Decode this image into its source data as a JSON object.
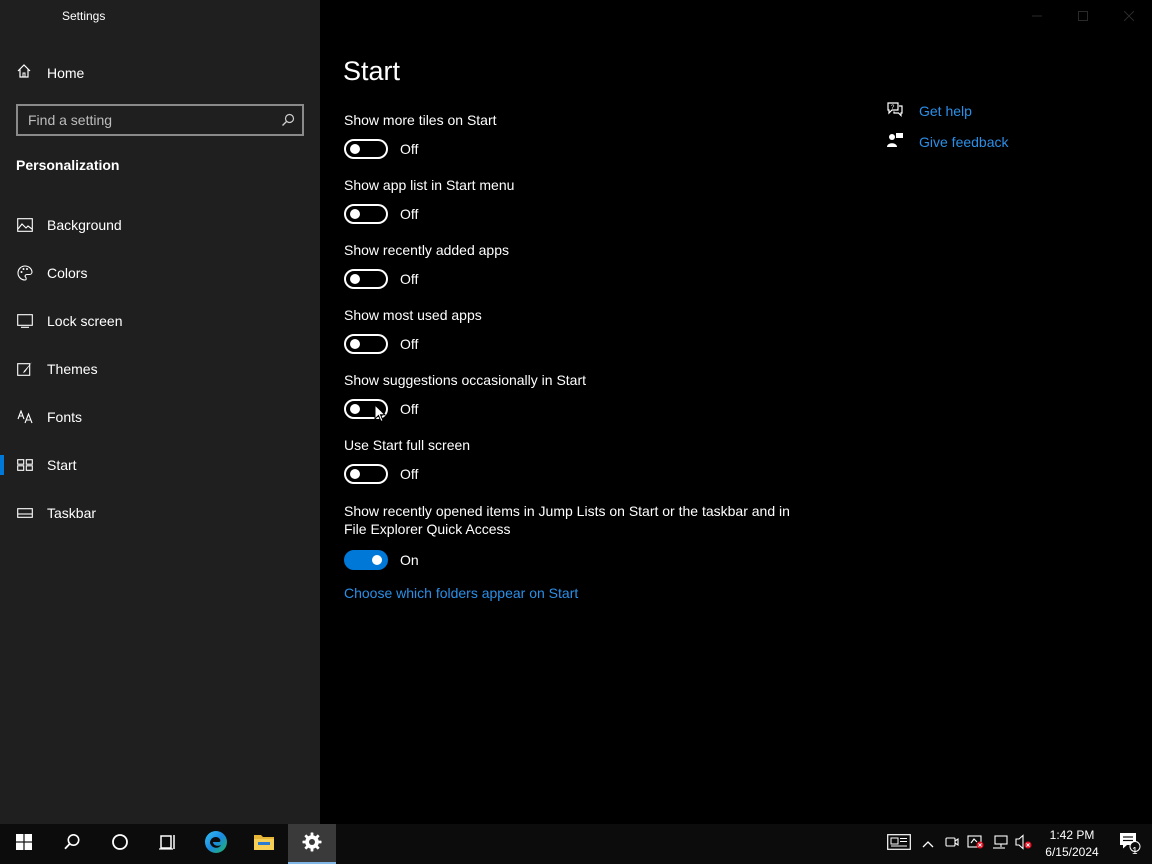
{
  "window": {
    "title": "Settings"
  },
  "sidebar": {
    "home_label": "Home",
    "search_placeholder": "Find a setting",
    "section_title": "Personalization",
    "items": [
      {
        "label": "Background",
        "icon": "picture-icon"
      },
      {
        "label": "Colors",
        "icon": "palette-icon"
      },
      {
        "label": "Lock screen",
        "icon": "lock-screen-icon"
      },
      {
        "label": "Themes",
        "icon": "brush-icon"
      },
      {
        "label": "Fonts",
        "icon": "font-icon"
      },
      {
        "label": "Start",
        "icon": "start-layout-icon",
        "active": true
      },
      {
        "label": "Taskbar",
        "icon": "taskbar-icon"
      }
    ]
  },
  "main": {
    "title": "Start",
    "settings": [
      {
        "label": "Show more tiles on Start",
        "state": "Off"
      },
      {
        "label": "Show app list in Start menu",
        "state": "Off"
      },
      {
        "label": "Show recently added apps",
        "state": "Off"
      },
      {
        "label": "Show most used apps",
        "state": "Off"
      },
      {
        "label": "Show suggestions occasionally in Start",
        "state": "Off"
      },
      {
        "label": "Use Start full screen",
        "state": "Off"
      },
      {
        "label": "Show recently opened items in Jump Lists on Start or the taskbar and in File Explorer Quick Access",
        "state": "On"
      }
    ],
    "folders_link": "Choose which folders appear on Start"
  },
  "help": {
    "get_help": "Get help",
    "give_feedback": "Give feedback"
  },
  "taskbar": {
    "time": "1:42 PM",
    "date": "6/15/2024",
    "notification_count": "1"
  },
  "colors": {
    "accent": "#0078d7",
    "link": "#2b8fe8",
    "sidebar_bg": "#1f1f1f",
    "main_bg": "#000000"
  }
}
